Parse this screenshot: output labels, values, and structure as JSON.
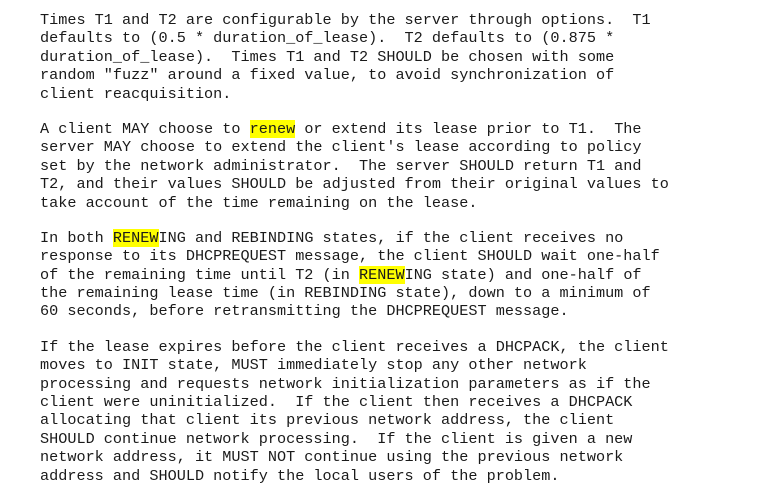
{
  "highlight_color": "#ffff00",
  "document": {
    "paragraphs": [
      {
        "lines": [
          [
            {
              "text": "Times T1 and T2 are configurable by the server through options.  T1"
            }
          ],
          [
            {
              "text": "defaults to (0.5 * duration_of_lease).  T2 defaults to (0.875 *"
            }
          ],
          [
            {
              "text": "duration_of_lease).  Times T1 and T2 SHOULD be chosen with some"
            }
          ],
          [
            {
              "text": "random \"fuzz\" around a fixed value, to avoid synchronization of"
            }
          ],
          [
            {
              "text": "client reacquisition."
            }
          ]
        ]
      },
      {
        "lines": [
          [
            {
              "text": "A client MAY choose to "
            },
            {
              "text": "renew",
              "highlight": true
            },
            {
              "text": " or extend its lease prior to T1.  The"
            }
          ],
          [
            {
              "text": "server MAY choose to extend the client's lease according to policy"
            }
          ],
          [
            {
              "text": "set by the network administrator.  The server SHOULD return T1 and"
            }
          ],
          [
            {
              "text": "T2, and their values SHOULD be adjusted from their original values to"
            }
          ],
          [
            {
              "text": "take account of the time remaining on the lease."
            }
          ]
        ]
      },
      {
        "lines": [
          [
            {
              "text": "In both "
            },
            {
              "text": "RENEW",
              "highlight": true
            },
            {
              "text": "ING and REBINDING states, if the client receives no"
            }
          ],
          [
            {
              "text": "response to its DHCPREQUEST message, the client SHOULD wait one-half"
            }
          ],
          [
            {
              "text": "of the remaining time until T2 (in "
            },
            {
              "text": "RENEW",
              "highlight": true
            },
            {
              "text": "ING state) and one-half of"
            }
          ],
          [
            {
              "text": "the remaining lease time (in REBINDING state), down to a minimum of"
            }
          ],
          [
            {
              "text": "60 seconds, before retransmitting the DHCPREQUEST message."
            }
          ]
        ]
      },
      {
        "lines": [
          [
            {
              "text": "If the lease expires before the client receives a DHCPACK, the client"
            }
          ],
          [
            {
              "text": "moves to INIT state, MUST immediately stop any other network"
            }
          ],
          [
            {
              "text": "processing and requests network initialization parameters as if the"
            }
          ],
          [
            {
              "text": "client were uninitialized.  If the client then receives a DHCPACK"
            }
          ],
          [
            {
              "text": "allocating that client its previous network address, the client"
            }
          ],
          [
            {
              "text": "SHOULD continue network processing.  If the client is given a new"
            }
          ],
          [
            {
              "text": "network address, it MUST NOT continue using the previous network"
            }
          ],
          [
            {
              "text": "address and SHOULD notify the local users of the problem."
            }
          ]
        ]
      }
    ]
  }
}
